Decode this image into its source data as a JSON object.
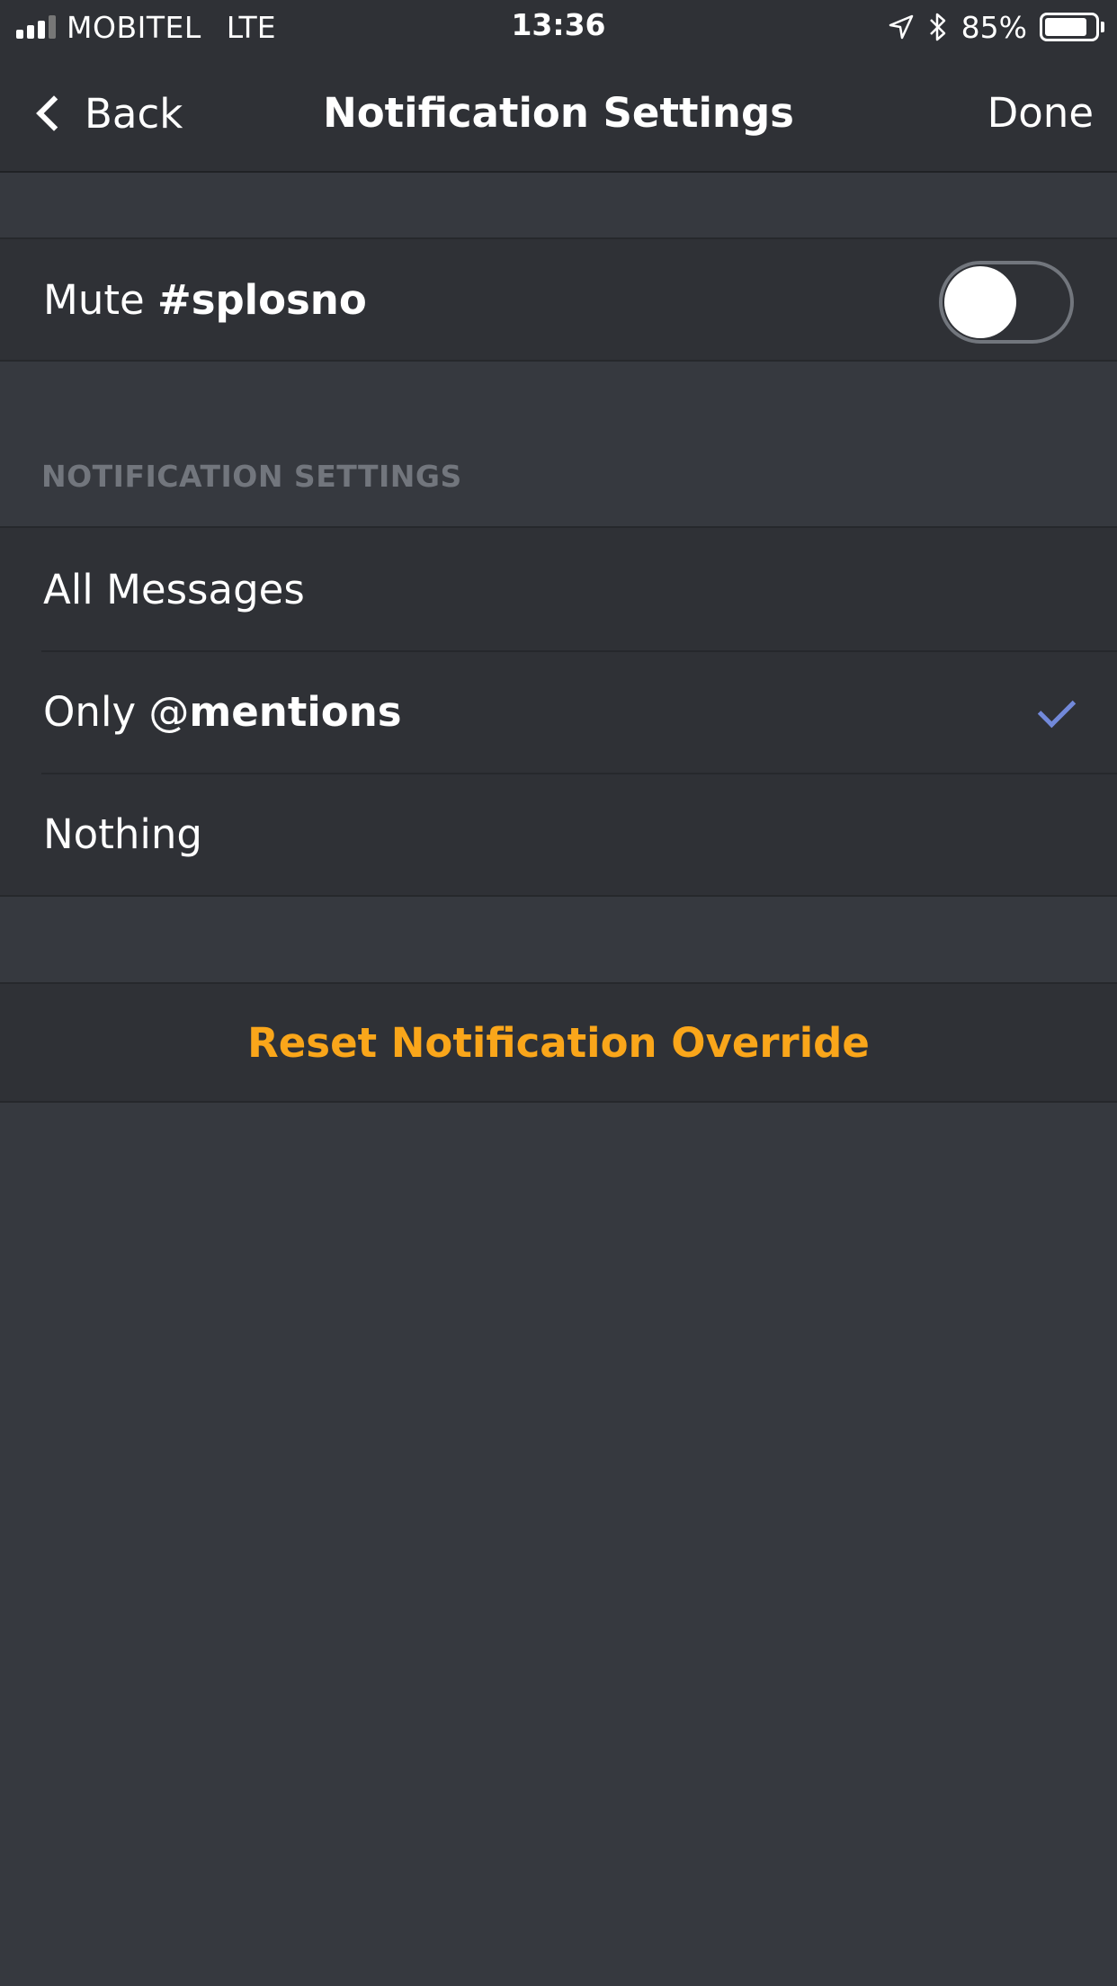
{
  "status_bar": {
    "carrier": "MOBITEL",
    "network": "LTE",
    "time": "13:36",
    "battery": "85%",
    "battery_level": 0.85,
    "icons": [
      "signal-icon",
      "location-icon",
      "bluetooth-icon",
      "battery-icon"
    ]
  },
  "nav": {
    "back_label": "Back",
    "title": "Notification Settings",
    "done_label": "Done"
  },
  "mute": {
    "prefix": "Mute ",
    "channel": "#splosno",
    "enabled": false
  },
  "section": {
    "header": "NOTIFICATION SETTINGS"
  },
  "options": [
    {
      "label": "All Messages",
      "selected": false
    },
    {
      "label_prefix": "Only @",
      "label_bold": "mentions",
      "selected": true
    },
    {
      "label": "Nothing",
      "selected": false
    }
  ],
  "reset": {
    "label": "Reset Notification Override"
  },
  "colors": {
    "background": "#36393f",
    "row": "#2f3136",
    "accent_check": "#7289da",
    "reset_text": "#faa61a",
    "header_text": "#72767d"
  }
}
